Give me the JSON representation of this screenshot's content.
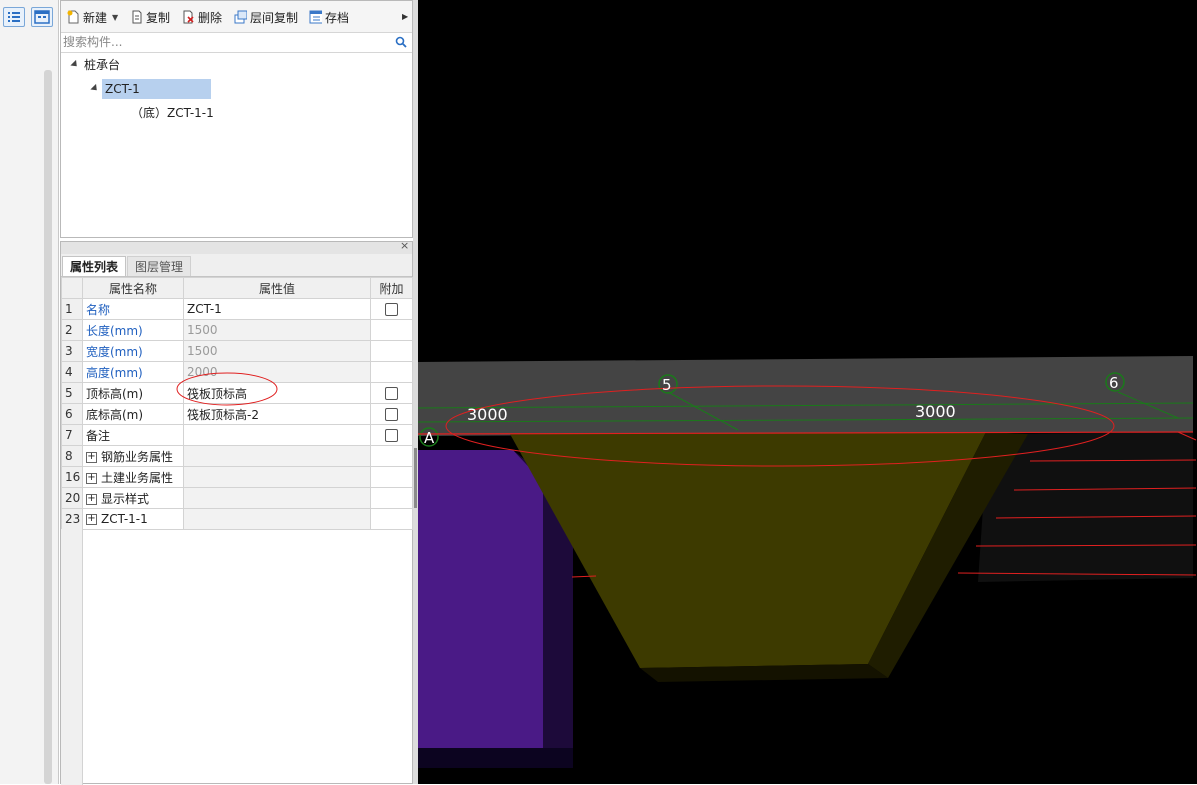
{
  "toolbar": {
    "new_label": "新建",
    "copy_label": "复制",
    "delete_label": "删除",
    "floor_copy_label": "层间复制",
    "save_label": "存档"
  },
  "search": {
    "placeholder": "搜索构件..."
  },
  "tree": {
    "root": "桩承台",
    "child": "ZCT-1",
    "grandchild": "（底）ZCT-1-1"
  },
  "prop_panel": {
    "tabs": [
      "属性列表",
      "图层管理"
    ],
    "columns": [
      "",
      "属性名称",
      "属性值",
      "附加"
    ],
    "rows": [
      {
        "num": "1",
        "name": "名称",
        "value": "ZCT-1"
      },
      {
        "num": "2",
        "name": "长度(mm)",
        "value": "1500"
      },
      {
        "num": "3",
        "name": "宽度(mm)",
        "value": "1500"
      },
      {
        "num": "4",
        "name": "高度(mm)",
        "value": "2000"
      },
      {
        "num": "5",
        "name": "顶标高(m)",
        "value": "筏板顶标高"
      },
      {
        "num": "6",
        "name": "底标高(m)",
        "value": "筏板顶标高-2"
      },
      {
        "num": "7",
        "name": "备注",
        "value": ""
      },
      {
        "num": "8",
        "name": "钢筋业务属性",
        "value": ""
      },
      {
        "num": "16",
        "name": "土建业务属性",
        "value": ""
      },
      {
        "num": "20",
        "name": "显示样式",
        "value": ""
      },
      {
        "num": "23",
        "name": "ZCT-1-1",
        "value": ""
      }
    ]
  },
  "viewport": {
    "dim_left": "3000",
    "dim_right": "3000",
    "axis_5": "5",
    "axis_6": "6",
    "axis_a": "A"
  },
  "colors": {
    "selected": "#b7d0ee",
    "link_blue": "#1f5fbf",
    "slab": "#3a3a3a",
    "pile_cap": "#3d3a00",
    "column": "#4a1a86",
    "annotation_red": "#e02020",
    "grid_green": "#1a7a1a"
  }
}
